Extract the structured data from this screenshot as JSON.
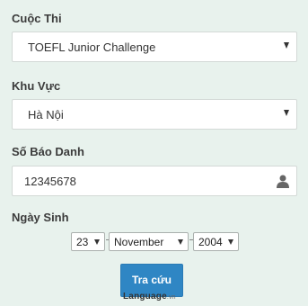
{
  "form": {
    "contest_label": "Cuộc Thi",
    "contest_value": "TOEFL Junior Challenge",
    "region_label": "Khu Vực",
    "region_value": "Hà Nội",
    "id_label": "Số Báo Danh",
    "id_value": "12345678",
    "dob_label": "Ngày Sinh",
    "dob_day": "23",
    "dob_month": "November",
    "dob_year": "2004",
    "submit_label": "Tra cứu"
  },
  "watermark": {
    "text": "Language",
    "suffix": ".vn"
  },
  "colors": {
    "background": "#e8f2ed",
    "button": "#2f86c4"
  },
  "icons": {
    "id_field": "user-icon",
    "selects": "caret-down-icon"
  }
}
